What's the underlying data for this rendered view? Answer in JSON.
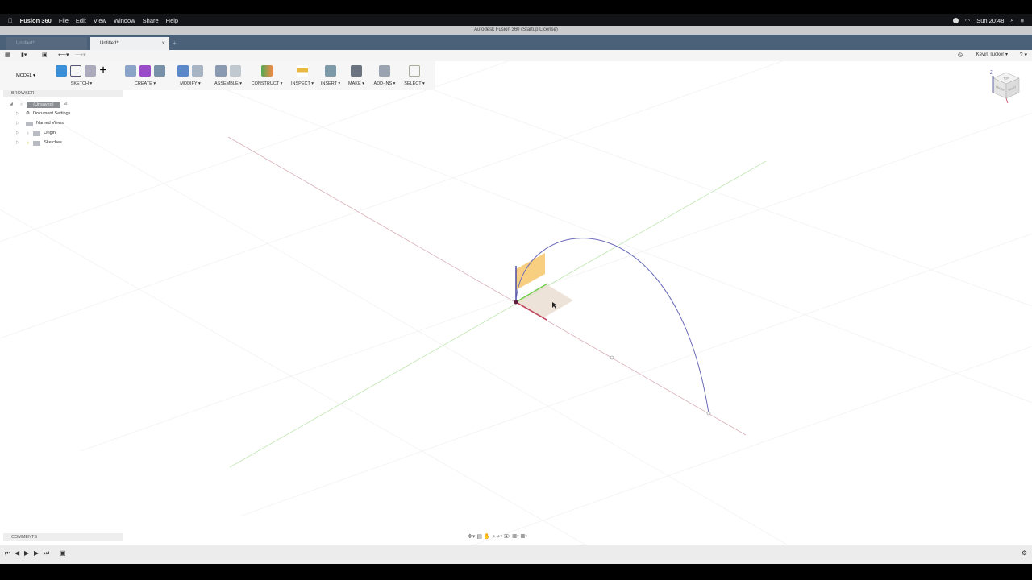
{
  "menubar": {
    "apple": "",
    "app": "Fusion 360",
    "items": [
      "File",
      "Edit",
      "View",
      "Window",
      "Share",
      "Help"
    ],
    "clock": "Sun 20:48"
  },
  "window_title": "Autodesk Fusion 360 (Startup License)",
  "tabs": [
    {
      "label": "Untitled*",
      "active": false
    },
    {
      "label": "Untitled*",
      "active": true
    }
  ],
  "toolbar": {
    "workspace": "MODEL ▾",
    "groups": [
      "SKETCH ▾",
      "CREATE ▾",
      "MODIFY ▾",
      "ASSEMBLE ▾",
      "CONSTRUCT ▾",
      "INSPECT ▾",
      "INSERT ▾",
      "MAKE ▾",
      "ADD-INS ▾",
      "SELECT ▾"
    ]
  },
  "user": {
    "name": "Kevin Tucker ▾",
    "help": "? ▾"
  },
  "browser": {
    "title": "BROWSER",
    "root": "(Unsaved)",
    "items": [
      "Document Settings",
      "Named Views",
      "Origin",
      "Sketches"
    ]
  },
  "comments": {
    "title": "COMMENTS"
  },
  "viewcube": {
    "axis_z": "Z",
    "faces": [
      "TOP",
      "FRONT",
      "RIGHT"
    ]
  },
  "colors": {
    "tabbar": "#4b6079",
    "x_axis": "#c0405a",
    "y_axis": "#6fcf4a",
    "z_axis": "#4a4aa0",
    "arc": "#6a6ab8",
    "plane": "#f5b94a"
  }
}
